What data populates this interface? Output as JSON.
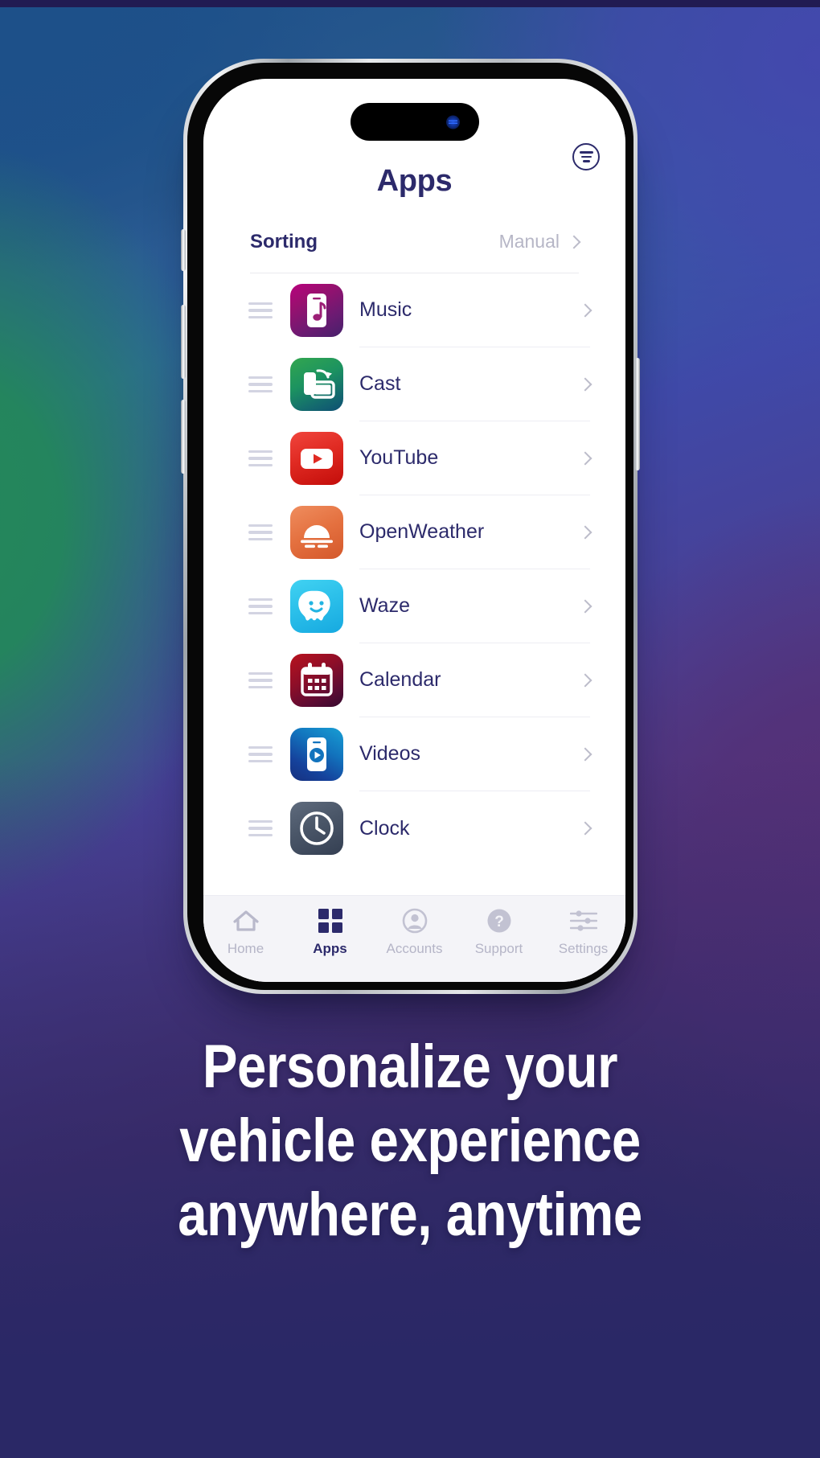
{
  "background": {
    "colors": {
      "blue": "#1d5089",
      "green": "#23875a",
      "indigo": "#4348ad",
      "purple": "#553077",
      "navy": "#2a2866",
      "top_bar": "#211b52"
    }
  },
  "phone": {
    "device": "smartphone-mockup",
    "island": "dynamic-island",
    "buttons": [
      "mute-switch",
      "volume-up",
      "volume-down",
      "power"
    ]
  },
  "app": {
    "header": {
      "title": "Apps",
      "menu_icon": "filter-menu-icon"
    },
    "sorting": {
      "label": "Sorting",
      "value": "Manual",
      "chevron": "chevron-right-icon"
    },
    "apps": [
      {
        "name": "Music",
        "icon": "music-app-icon",
        "icon_class": "ic-music",
        "glyph": "phone-music-note"
      },
      {
        "name": "Cast",
        "icon": "cast-app-icon",
        "icon_class": "ic-cast",
        "glyph": "phone-to-screen"
      },
      {
        "name": "YouTube",
        "icon": "youtube-app-icon",
        "icon_class": "ic-youtube",
        "glyph": "play-button"
      },
      {
        "name": "OpenWeather",
        "icon": "openweather-app-icon",
        "icon_class": "ic-weather",
        "glyph": "sun-fog"
      },
      {
        "name": "Waze",
        "icon": "waze-app-icon",
        "icon_class": "ic-waze",
        "glyph": "waze-ghost-face"
      },
      {
        "name": "Calendar",
        "icon": "calendar-app-icon",
        "icon_class": "ic-calendar",
        "glyph": "calendar-grid"
      },
      {
        "name": "Videos",
        "icon": "videos-app-icon",
        "icon_class": "ic-videos",
        "glyph": "phone-play"
      },
      {
        "name": "Clock",
        "icon": "clock-app-icon",
        "icon_class": "ic-clock",
        "glyph": "analog-clock"
      }
    ],
    "row_chevron": "chevron-right-icon",
    "drag_handle": "drag-handle-icon",
    "tabs": [
      {
        "label": "Home",
        "icon": "home-icon",
        "active": false
      },
      {
        "label": "Apps",
        "icon": "grid-icon",
        "active": true
      },
      {
        "label": "Accounts",
        "icon": "person-icon",
        "active": false
      },
      {
        "label": "Support",
        "icon": "question-icon",
        "active": false
      },
      {
        "label": "Settings",
        "icon": "sliders-icon",
        "active": false
      }
    ]
  },
  "headline": {
    "line1": "Personalize your",
    "line2": "vehicle experience",
    "line3": "anywhere, anytime"
  }
}
